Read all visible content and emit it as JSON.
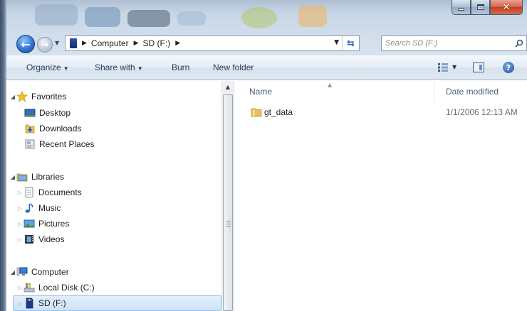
{
  "window": {
    "controls": {
      "minimize": "minimize",
      "maximize": "maximize",
      "close": "close"
    }
  },
  "address_bar": {
    "crumbs": [
      "Computer",
      "SD (F:)"
    ],
    "search_placeholder": "Search SD (F:)"
  },
  "command_bar": {
    "organize": "Organize",
    "share_with": "Share with",
    "burn": "Burn",
    "new_folder": "New folder"
  },
  "nav_pane": {
    "favorites": {
      "label": "Favorites",
      "items": [
        {
          "label": "Desktop",
          "icon": "desktop-icon"
        },
        {
          "label": "Downloads",
          "icon": "downloads-folder-icon"
        },
        {
          "label": "Recent Places",
          "icon": "recent-places-icon"
        }
      ]
    },
    "libraries": {
      "label": "Libraries",
      "items": [
        {
          "label": "Documents",
          "icon": "documents-icon"
        },
        {
          "label": "Music",
          "icon": "music-icon"
        },
        {
          "label": "Pictures",
          "icon": "pictures-icon"
        },
        {
          "label": "Videos",
          "icon": "videos-icon"
        }
      ]
    },
    "computer": {
      "label": "Computer",
      "items": [
        {
          "label": "Local Disk (C:)",
          "icon": "local-disk-icon"
        },
        {
          "label": "SD (F:)",
          "icon": "sd-card-icon",
          "selected": true
        }
      ]
    }
  },
  "content": {
    "columns": {
      "name": "Name",
      "date_modified": "Date modified"
    },
    "files": [
      {
        "name": "gt_data",
        "date_modified": "1/1/2006 12:13 AM",
        "type": "folder"
      }
    ]
  },
  "colors": {
    "title_bar": "#c6d5e4",
    "command_bar": "#e4ecf5",
    "selection": "#cde2f7",
    "close_button": "#c13e22",
    "folder_yellow": "#e8c25a"
  }
}
